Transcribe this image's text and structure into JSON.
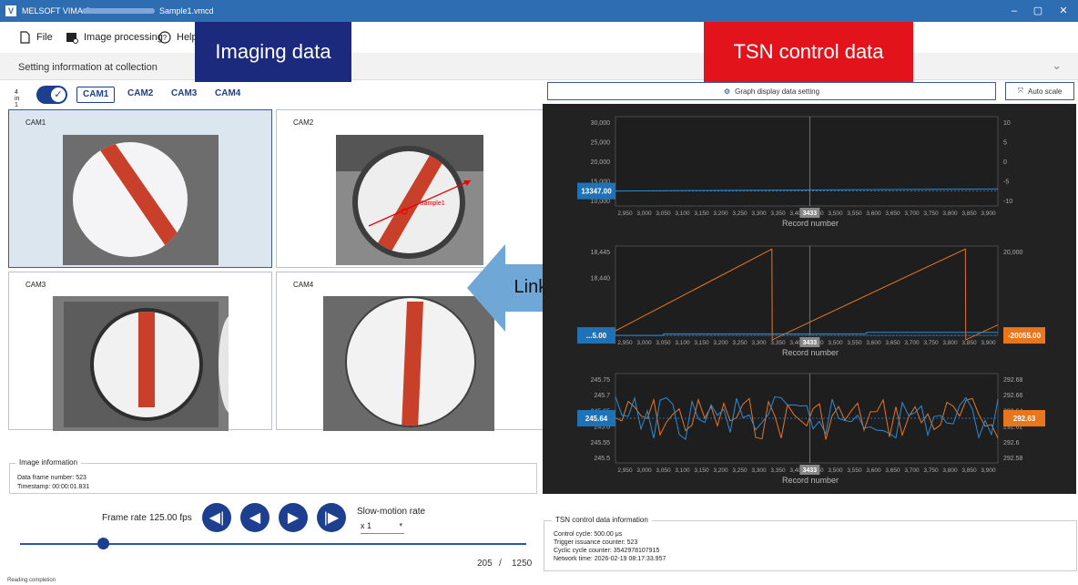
{
  "window": {
    "app_name": "MELSOFT VIMA C",
    "file_name": "Sample1.vmcd",
    "min": "–",
    "max": "▢",
    "close": "✕"
  },
  "menu": {
    "file": "File",
    "image_processing": "Image processing",
    "help": "Help"
  },
  "setting_bar": {
    "label": "Setting information at collection"
  },
  "callouts": {
    "imaging": "Imaging data",
    "tsn": "TSN control data",
    "linked": "Linked"
  },
  "colors": {
    "imaging_callout": "#1c2a7d",
    "tsn_callout": "#e3131b",
    "linked_arrow": "#6fa8d6",
    "accent": "#1c3f8f",
    "series_blue": "#2a8bd8",
    "series_orange": "#e8761e"
  },
  "cam_view": {
    "mode_label": "4 in 1",
    "tabs": [
      "CAM1",
      "CAM2",
      "CAM3",
      "CAM4"
    ],
    "active_tab": "CAM1"
  },
  "panels": [
    {
      "label": "CAM1"
    },
    {
      "label": "CAM2",
      "overlay": "Sample1"
    },
    {
      "label": "CAM3"
    },
    {
      "label": "CAM4"
    }
  ],
  "image_info": {
    "title": "Image information",
    "frame": "Data frame number: 523",
    "timestamp": "Timestamp: 00:00:01.831"
  },
  "playback": {
    "frame_rate_label": "Frame rate",
    "frame_rate_value": "125.00 fps",
    "slow_label": "Slow-motion rate",
    "slow_value": "x 1",
    "position": 205,
    "total": 1250,
    "position_text": "205",
    "separator": "/",
    "total_text": "1250"
  },
  "status": "Reading completion",
  "graph_toolbar": {
    "setting": "Graph display data setting",
    "autoscale": "Auto scale"
  },
  "chart_data": [
    {
      "type": "line",
      "xlabel": "Record number",
      "xlim": [
        2925,
        3925
      ],
      "x_ticks": [
        "2,950",
        "3,000",
        "3,050",
        "3,100",
        "3,150",
        "3,200",
        "3,250",
        "3,300",
        "3,350",
        "3,400",
        "3,450",
        "3,500",
        "3,550",
        "3,600",
        "3,650",
        "3,700",
        "3,750",
        "3,800",
        "3,850",
        "3,900"
      ],
      "cursor": 3433,
      "cursor_label": "3433",
      "ylim_left": [
        10000,
        30000
      ],
      "yticks_left": [
        "30,000",
        "25,000",
        "20,000",
        "15,000",
        "10,000"
      ],
      "ylim_right": [
        -10,
        10
      ],
      "yticks_right": [
        "10",
        "5",
        "0",
        "-5",
        "-10"
      ],
      "series": [
        {
          "color": "#2a8bd8",
          "x": [
            2925,
            3925
          ],
          "y": [
            13347,
            13800
          ]
        }
      ],
      "value_label_left": "13347.00"
    },
    {
      "type": "line",
      "xlabel": "Record number",
      "xlim": [
        2925,
        3925
      ],
      "x_ticks": [
        "2,950",
        "3,000",
        "3,050",
        "3,100",
        "3,150",
        "3,200",
        "3,250",
        "3,300",
        "3,350",
        "3,400",
        "3,450",
        "3,500",
        "3,550",
        "3,600",
        "3,650",
        "3,700",
        "3,750",
        "3,800",
        "3,850",
        "3,900"
      ],
      "cursor": 3433,
      "cursor_label": "3433",
      "ylim_left": [
        18418,
        18447
      ],
      "yticks_left": [
        "18,445",
        "18,440",
        "",
        "18,420"
      ],
      "ylim_right": [
        -20000,
        40000
      ],
      "yticks_right": [
        "20,000",
        "0"
      ],
      "series": [
        {
          "color": "#e8761e",
          "x": [
            2925,
            3334,
            3335,
            3840,
            3841,
            3925
          ],
          "y": [
            -17000,
            38000,
            -23000,
            38000,
            -23000,
            -13000
          ]
        },
        {
          "color": "#2a8bd8",
          "x": [
            2925,
            3050,
            3051,
            3580,
            3581,
            3925
          ],
          "y": [
            -20055,
            -20055,
            -19000,
            -19000,
            -18000,
            -18000
          ]
        }
      ],
      "value_label_left": "...5.00",
      "value_label_right": "-20055.00"
    },
    {
      "type": "line",
      "xlabel": "Record number",
      "xlim": [
        2925,
        3925
      ],
      "x_ticks": [
        "2,950",
        "3,000",
        "3,050",
        "3,100",
        "3,150",
        "3,200",
        "3,250",
        "3,300",
        "3,350",
        "3,400",
        "3,450",
        "3,500",
        "3,550",
        "3,600",
        "3,650",
        "3,700",
        "3,750",
        "3,800",
        "3,850",
        "3,900"
      ],
      "cursor": 3433,
      "cursor_label": "3433",
      "ylim_left": [
        245.5,
        245.78
      ],
      "yticks_left": [
        "245.75",
        "245.7",
        "245.65",
        "245.6",
        "245.55",
        "245.5"
      ],
      "ylim_right": [
        292.56,
        292.7
      ],
      "yticks_right": [
        "292.68",
        "292.66",
        "292.64",
        "292.62",
        "292.6",
        "292.58"
      ],
      "series": [
        {
          "color": "#e8761e",
          "noise": true,
          "y_right": 292.63
        },
        {
          "color": "#2a8bd8",
          "noise": true,
          "y_left": 245.64
        }
      ],
      "value_label_left": "245.64",
      "value_label_right": "292.63"
    }
  ],
  "tsn_info": {
    "title": "TSN control data information",
    "cycle": "Control cycle: 500.00 μs",
    "trigger": "Trigger issuance counter: 523",
    "cyclic": "Cyclic cycle counter: 3542978107915",
    "network": "Network time: 2026-02-19 08:17:33.957"
  }
}
